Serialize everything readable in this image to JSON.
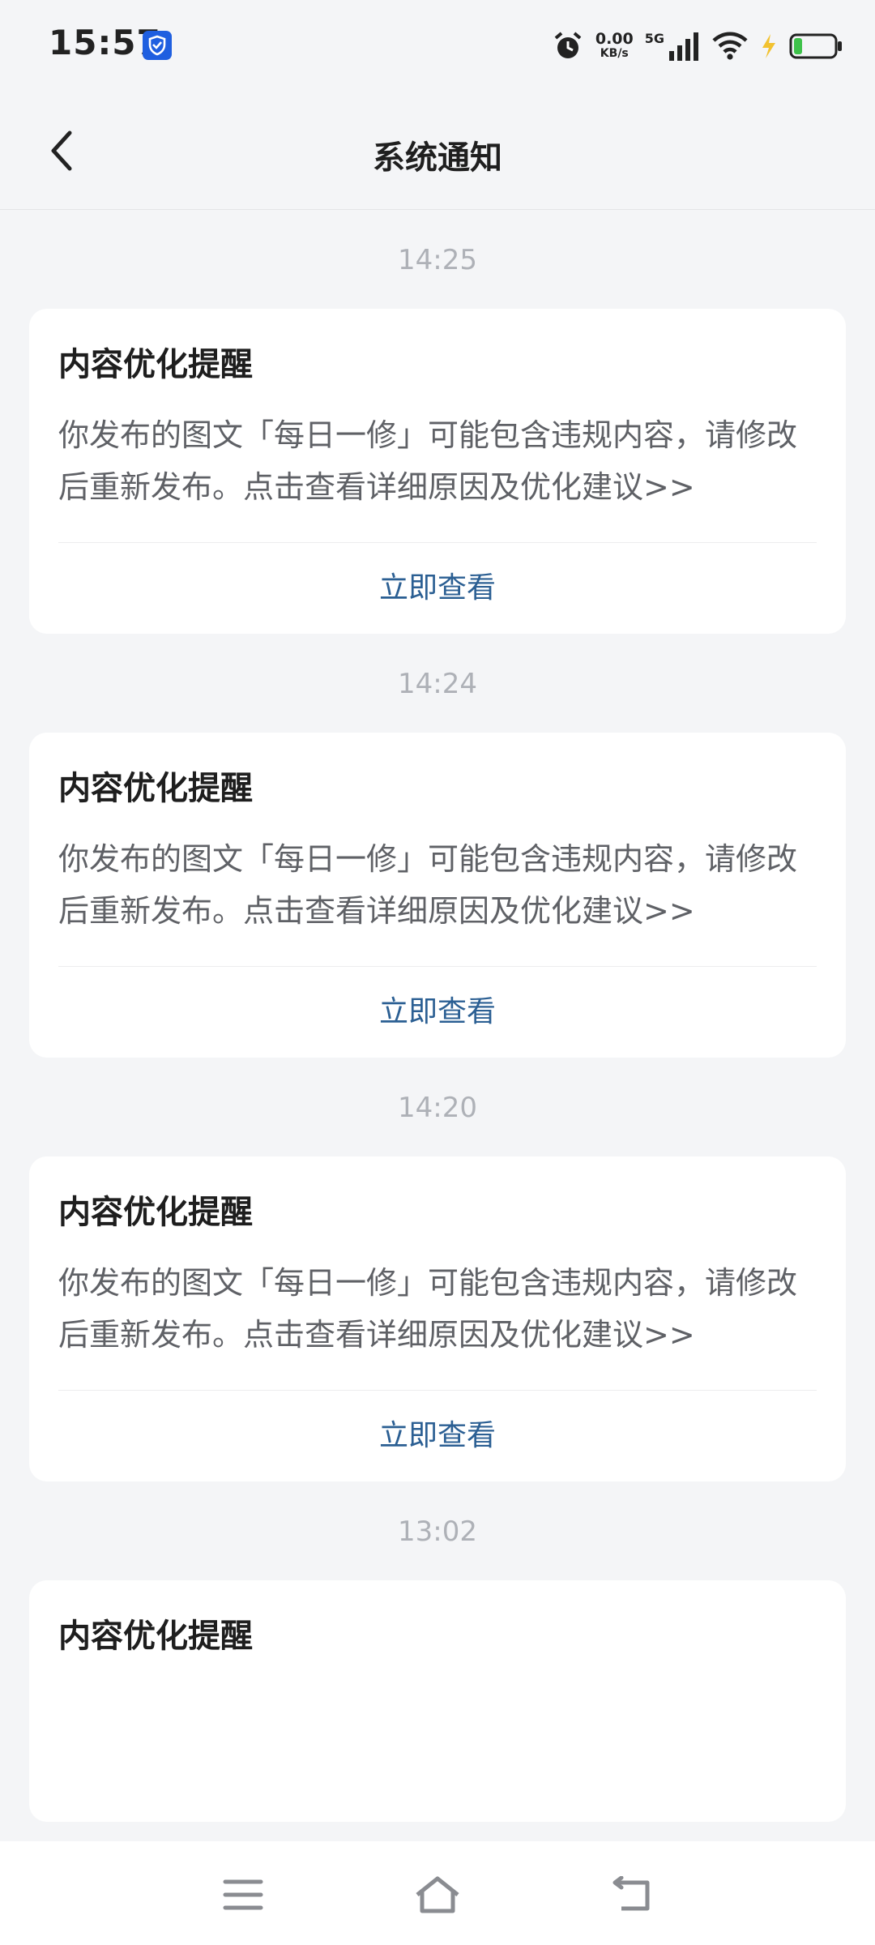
{
  "status_bar": {
    "time": "15:57",
    "net_speed_value": "0.00",
    "net_speed_unit": "KB/s",
    "network": "5G",
    "icons": [
      "shield-icon",
      "alarm-icon",
      "signal-icon",
      "wifi-icon",
      "charging-icon",
      "battery-icon"
    ]
  },
  "header": {
    "title": "系统通知"
  },
  "notifications": [
    {
      "time": "14:25",
      "title": "内容优化提醒",
      "body": "你发布的图文「每日一修」可能包含违规内容，请修改后重新发布。点击查看详细原因及优化建议>>",
      "action": "立即查看"
    },
    {
      "time": "14:24",
      "title": "内容优化提醒",
      "body": "你发布的图文「每日一修」可能包含违规内容，请修改后重新发布。点击查看详细原因及优化建议>>",
      "action": "立即查看"
    },
    {
      "time": "14:20",
      "title": "内容优化提醒",
      "body": "你发布的图文「每日一修」可能包含违规内容，请修改后重新发布。点击查看详细原因及优化建议>>",
      "action": "立即查看"
    },
    {
      "time": "13:02",
      "title": "内容优化提醒",
      "body": "",
      "action": ""
    }
  ],
  "nav_bar": {
    "icons": [
      "menu-icon",
      "home-icon",
      "back-icon"
    ]
  },
  "colors": {
    "background": "#f4f5f7",
    "card": "#ffffff",
    "action": "#2b5f93",
    "timestamp": "#aeb1b7"
  }
}
